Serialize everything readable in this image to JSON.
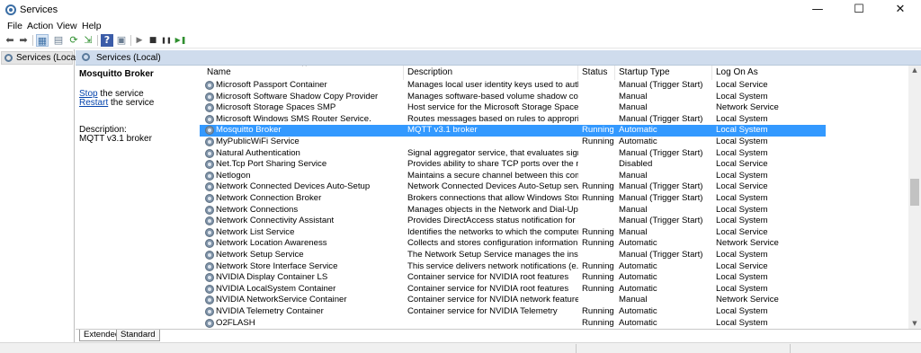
{
  "window": {
    "title": "Services",
    "minimize_glyph": "—",
    "maximize_glyph": "☐",
    "close_glyph": "✕"
  },
  "menu": [
    "File",
    "Action",
    "View",
    "Help"
  ],
  "toolbar": {
    "icons": [
      "back-arrow-icon",
      "forward-arrow-icon",
      "console-tree-icon",
      "properties-icon",
      "refresh-icon",
      "export-list-icon",
      "help-icon",
      "mmc-icon",
      "play-icon",
      "stop-icon",
      "pause-icon",
      "restart-icon"
    ],
    "glyphs": [
      "⬅",
      "➡",
      "▦",
      "▤",
      "⟳",
      "⇲",
      "?",
      "▣",
      "▶",
      "■",
      "❚❚",
      "▶❚"
    ]
  },
  "tree": {
    "item_label": "Services (Local)"
  },
  "right_header": {
    "label": "Services (Local)"
  },
  "detail": {
    "service_title": "Mosquitto Broker",
    "stop_link": "Stop",
    "stop_suffix": " the service",
    "restart_link": "Restart",
    "restart_suffix": " the service",
    "description_label": "Description:",
    "description_text": "MQTT v3.1 broker"
  },
  "columns": [
    "Name",
    "Description",
    "Status",
    "Startup Type",
    "Log On As"
  ],
  "services": [
    {
      "name": "Microsoft Passport Container",
      "description": "Manages local user identity keys used to authentica...",
      "status": "",
      "startup": "Manual (Trigger Start)",
      "logon": "Local Service",
      "selected": false
    },
    {
      "name": "Microsoft Software Shadow Copy Provider",
      "description": "Manages software-based volume shadow copies ta...",
      "status": "",
      "startup": "Manual",
      "logon": "Local System",
      "selected": false
    },
    {
      "name": "Microsoft Storage Spaces SMP",
      "description": "Host service for the Microsoft Storage Spaces mana...",
      "status": "",
      "startup": "Manual",
      "logon": "Network Service",
      "selected": false
    },
    {
      "name": "Microsoft Windows SMS Router Service.",
      "description": "Routes messages based on rules to appropriate clie...",
      "status": "",
      "startup": "Manual (Trigger Start)",
      "logon": "Local System",
      "selected": false
    },
    {
      "name": "Mosquitto Broker",
      "description": "MQTT v3.1 broker",
      "status": "Running",
      "startup": "Automatic",
      "logon": "Local System",
      "selected": true
    },
    {
      "name": "MyPublicWiFi Service",
      "description": "",
      "status": "Running",
      "startup": "Automatic",
      "logon": "Local System",
      "selected": false
    },
    {
      "name": "Natural Authentication",
      "description": "Signal aggregator service, that evaluates signals bas...",
      "status": "",
      "startup": "Manual (Trigger Start)",
      "logon": "Local System",
      "selected": false
    },
    {
      "name": "Net.Tcp Port Sharing Service",
      "description": "Provides ability to share TCP ports over the net.tcp ...",
      "status": "",
      "startup": "Disabled",
      "logon": "Local Service",
      "selected": false
    },
    {
      "name": "Netlogon",
      "description": "Maintains a secure channel between this computer ...",
      "status": "",
      "startup": "Manual",
      "logon": "Local System",
      "selected": false
    },
    {
      "name": "Network Connected Devices Auto-Setup",
      "description": "Network Connected Devices Auto-Setup service m...",
      "status": "Running",
      "startup": "Manual (Trigger Start)",
      "logon": "Local Service",
      "selected": false
    },
    {
      "name": "Network Connection Broker",
      "description": "Brokers connections that allow Windows Store App...",
      "status": "Running",
      "startup": "Manual (Trigger Start)",
      "logon": "Local System",
      "selected": false
    },
    {
      "name": "Network Connections",
      "description": "Manages objects in the Network and Dial-Up Conn...",
      "status": "",
      "startup": "Manual",
      "logon": "Local System",
      "selected": false
    },
    {
      "name": "Network Connectivity Assistant",
      "description": "Provides DirectAccess status notification for UI co...",
      "status": "",
      "startup": "Manual (Trigger Start)",
      "logon": "Local System",
      "selected": false
    },
    {
      "name": "Network List Service",
      "description": "Identifies the networks to which the computer has ...",
      "status": "Running",
      "startup": "Manual",
      "logon": "Local Service",
      "selected": false
    },
    {
      "name": "Network Location Awareness",
      "description": "Collects and stores configuration information for t...",
      "status": "Running",
      "startup": "Automatic",
      "logon": "Network Service",
      "selected": false
    },
    {
      "name": "Network Setup Service",
      "description": "The Network Setup Service manages the installatio...",
      "status": "",
      "startup": "Manual (Trigger Start)",
      "logon": "Local System",
      "selected": false
    },
    {
      "name": "Network Store Interface Service",
      "description": "This service delivers network notifications (e.g. inte...",
      "status": "Running",
      "startup": "Automatic",
      "logon": "Local Service",
      "selected": false
    },
    {
      "name": "NVIDIA Display Container LS",
      "description": "Container service for NVIDIA root features",
      "status": "Running",
      "startup": "Automatic",
      "logon": "Local System",
      "selected": false
    },
    {
      "name": "NVIDIA LocalSystem Container",
      "description": "Container service for NVIDIA root features",
      "status": "Running",
      "startup": "Automatic",
      "logon": "Local System",
      "selected": false
    },
    {
      "name": "NVIDIA NetworkService Container",
      "description": "Container service for NVIDIA network features",
      "status": "",
      "startup": "Manual",
      "logon": "Network Service",
      "selected": false
    },
    {
      "name": "NVIDIA Telemetry Container",
      "description": "Container service for NVIDIA Telemetry",
      "status": "Running",
      "startup": "Automatic",
      "logon": "Local System",
      "selected": false
    },
    {
      "name": "O2FLASH",
      "description": "",
      "status": "Running",
      "startup": "Automatic",
      "logon": "Local System",
      "selected": false
    }
  ],
  "tabs": [
    "Extended",
    "Standard"
  ]
}
